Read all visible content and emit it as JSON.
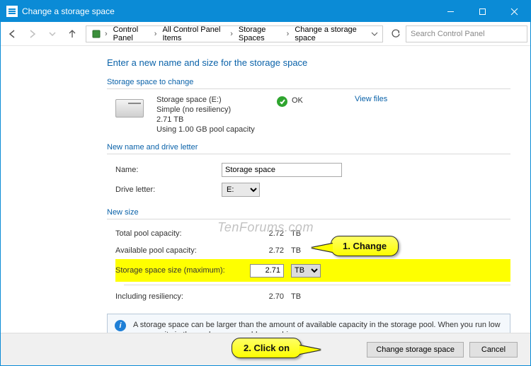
{
  "window": {
    "title": "Change a storage space"
  },
  "breadcrumb": {
    "items": [
      "Control Panel",
      "All Control Panel Items",
      "Storage Spaces",
      "Change a storage space"
    ]
  },
  "search": {
    "placeholder": "Search Control Panel"
  },
  "page": {
    "heading": "Enter a new name and size for the storage space",
    "section_change": "Storage space to change",
    "space_name": "Storage space (E:)",
    "space_resiliency": "Simple (no resiliency)",
    "space_size": "2.71 TB",
    "space_usage": "Using 1.00 GB pool capacity",
    "status": "OK",
    "view_files": "View files",
    "section_name": "New name and drive letter",
    "name_label": "Name:",
    "name_value": "Storage space",
    "drive_label": "Drive letter:",
    "drive_value": "E:",
    "section_size": "New size",
    "rows": {
      "total": {
        "label": "Total pool capacity:",
        "value": "2.72",
        "unit": "TB"
      },
      "avail": {
        "label": "Available pool capacity:",
        "value": "2.72",
        "unit": "TB"
      },
      "max": {
        "label": "Storage space size (maximum):",
        "value": "2.71",
        "unit": "TB"
      },
      "resil": {
        "label": "Including resiliency:",
        "value": "2.70",
        "unit": "TB"
      }
    },
    "info": "A storage space can be larger than the amount of available capacity in the storage pool. When you run low on capacity in the pool, you can add more drives."
  },
  "footer": {
    "primary": "Change storage space",
    "cancel": "Cancel"
  },
  "callouts": {
    "c1": "1. Change",
    "c2": "2. Click on"
  },
  "watermark": "TenForums.com"
}
